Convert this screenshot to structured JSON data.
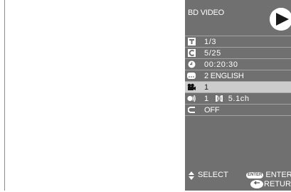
{
  "header": {
    "title": "BD VIDEO",
    "play_icon": "play-icon"
  },
  "rows": [
    {
      "icon": "title-icon",
      "value": "1/3"
    },
    {
      "icon": "chapter-icon",
      "value": "5/25"
    },
    {
      "icon": "clock-icon",
      "value": "00:20:30"
    },
    {
      "icon": "subtitle-icon",
      "value": "2 ENGLISH"
    },
    {
      "icon": "angle-icon",
      "value": "1"
    },
    {
      "icon": "audio-icon",
      "value": "1",
      "format": "5.1ch"
    },
    {
      "icon": "repeat-icon",
      "value": "OFF"
    }
  ],
  "footer": {
    "select_label": "SELECT",
    "enter_key": "ENTER",
    "enter_label": "ENTER",
    "return_label": "RETURN"
  },
  "colors": {
    "panel": "#707070",
    "highlight": "#cccccc",
    "text": "#ffffff"
  }
}
